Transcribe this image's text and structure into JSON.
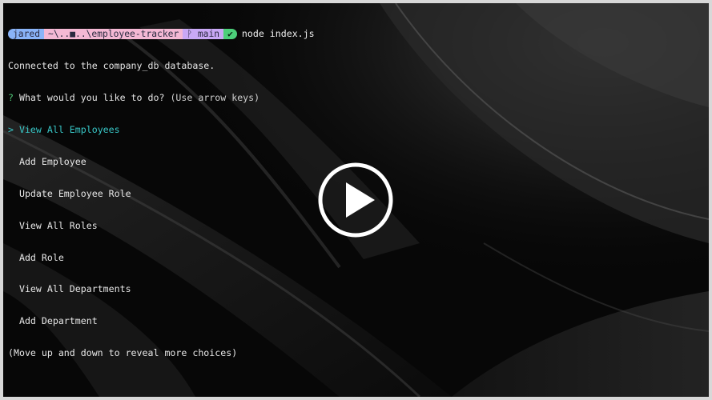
{
  "prompt": {
    "user": "jared",
    "path": "~\\..■..\\employee-tracker",
    "branch_icon": "git-branch-icon",
    "branch": "main",
    "status_icon": "check-icon",
    "command": "node index.js"
  },
  "output": {
    "connected": "Connected to the company_db database.",
    "question_mark": "?",
    "question": "What would you like to do?",
    "question_hint": "(Use arrow keys)",
    "pointer": ">",
    "choices": [
      "View All Employees",
      "Add Employee",
      "Update Employee Role",
      "View All Roles",
      "Add Role",
      "View All Departments",
      "Add Department"
    ],
    "footer": "(Move up and down to reveal more choices)"
  },
  "overlay": {
    "play_icon": "play-icon"
  },
  "colors": {
    "user_segment": "#8ab4f8",
    "path_segment": "#f4b8d4",
    "branch_segment": "#c9a8f5",
    "status_segment": "#4ccf7a",
    "selected_choice": "#38c7c7"
  }
}
